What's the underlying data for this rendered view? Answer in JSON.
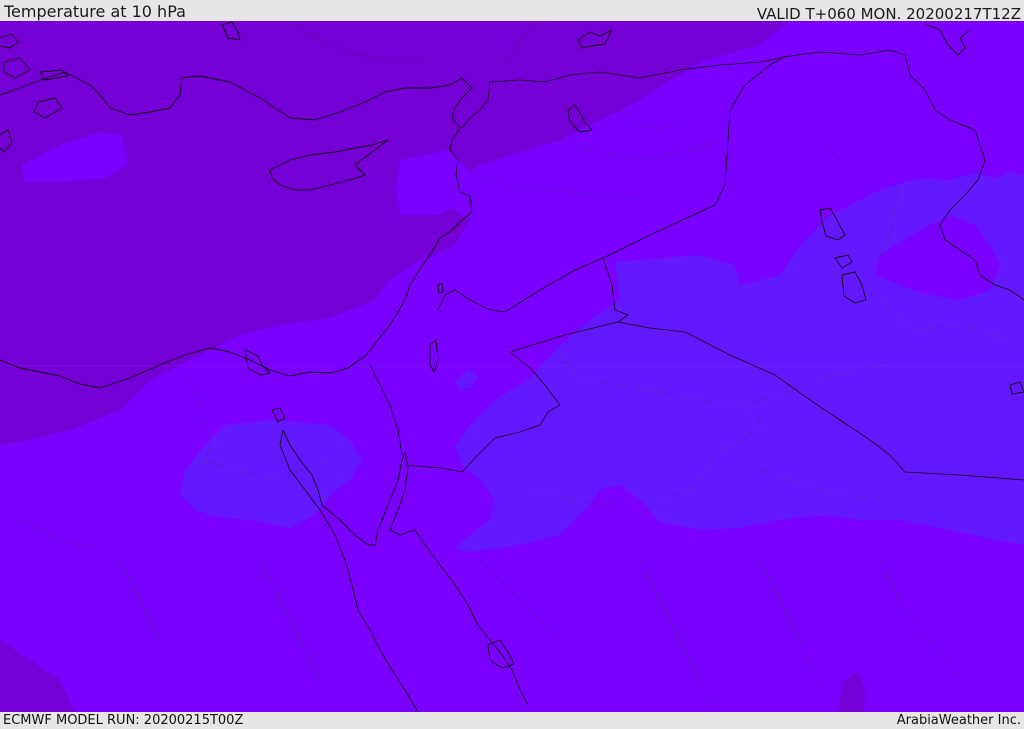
{
  "header": {
    "title": "Temperature at 10 hPa",
    "valid": "VALID T+060 MON. 20200217T12Z"
  },
  "footer": {
    "model_run": "ECMWF MODEL RUN: 20200215T00Z",
    "credit": "ArabiaWeather Inc."
  },
  "colors": {
    "warmer_band": "#7400d6",
    "mid_band": "#7a00ff",
    "cold_band": "#6418ff",
    "coastline": "#111111",
    "frame": "#e6e6e6"
  }
}
